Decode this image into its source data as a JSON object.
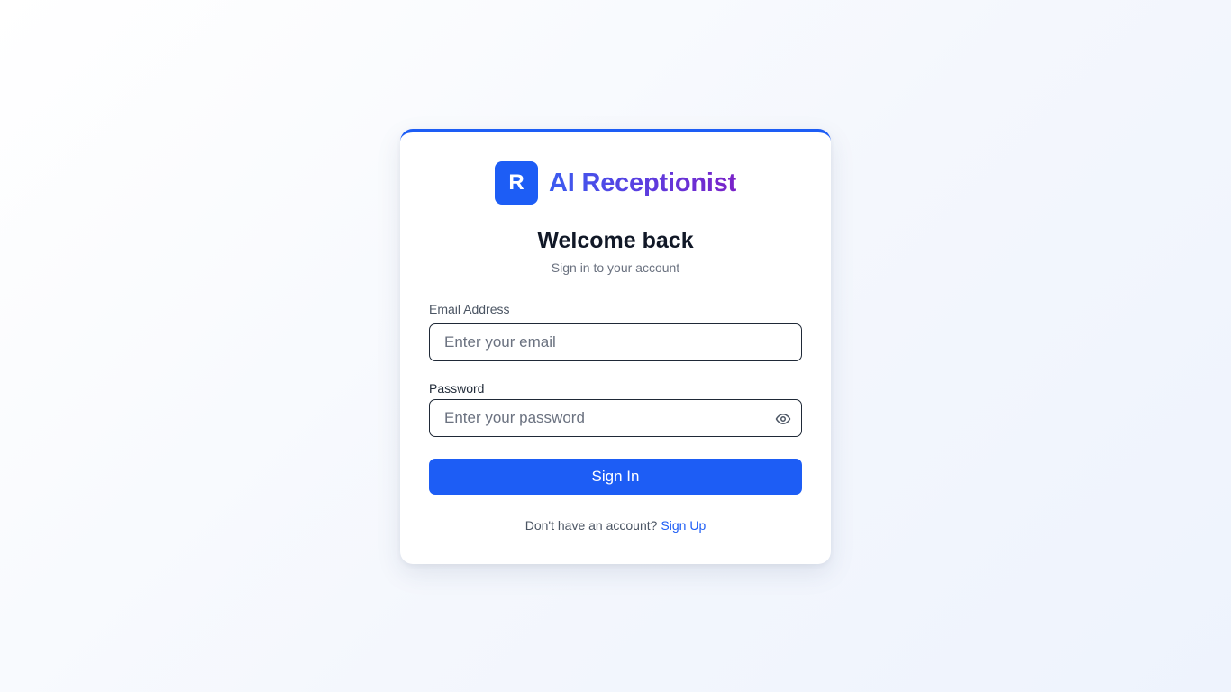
{
  "brand": {
    "logo_letter": "R",
    "name": "AI Receptionist"
  },
  "heading": {
    "title": "Welcome back",
    "subtitle": "Sign in to your account"
  },
  "form": {
    "email": {
      "label": "Email Address",
      "placeholder": "Enter your email",
      "value": ""
    },
    "password": {
      "label": "Password",
      "placeholder": "Enter your password",
      "value": ""
    },
    "submit_label": "Sign In"
  },
  "footer": {
    "prompt": "Don't have an account?",
    "link_label": "Sign Up"
  },
  "colors": {
    "accent": "#1d5df5",
    "title_text": "#111827",
    "muted_text": "#6b7280"
  },
  "icons": {
    "password_toggle": "eye-icon"
  }
}
